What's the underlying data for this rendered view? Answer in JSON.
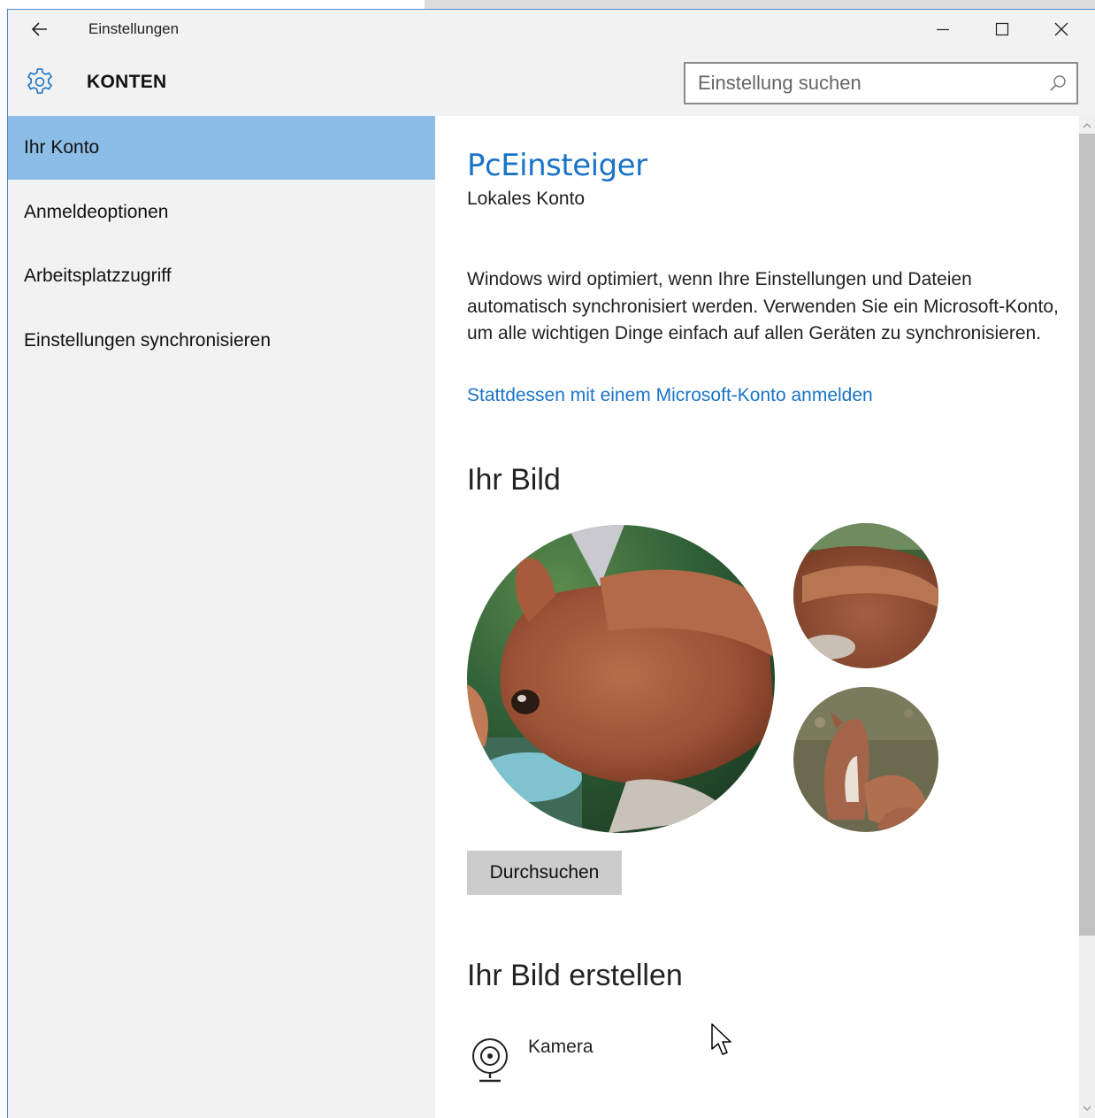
{
  "window": {
    "title": "Einstellungen",
    "controls": {
      "minimize": "minimize-icon",
      "maximize": "maximize-icon",
      "close": "close-icon"
    }
  },
  "header": {
    "section_title": "KONTEN",
    "search_placeholder": "Einstellung suchen"
  },
  "sidebar": {
    "items": [
      {
        "label": "Ihr Konto",
        "selected": true
      },
      {
        "label": "Anmeldeoptionen",
        "selected": false
      },
      {
        "label": "Arbeitsplatzzugriff",
        "selected": false
      },
      {
        "label": "Einstellungen synchronisieren",
        "selected": false
      }
    ]
  },
  "main": {
    "account_name": "PcEinsteiger",
    "account_type": "Lokales Konto",
    "info_text": "Windows wird optimiert, wenn Ihre Einstellungen und Dateien automatisch synchronisiert werden. Verwenden Sie ein Microsoft-Konto, um alle wichtigen Dinge einfach auf allen Geräten zu synchronisieren.",
    "ms_link": "Stattdessen mit einem Microsoft-Konto anmelden",
    "picture_heading": "Ihr Bild",
    "browse_button": "Durchsuchen",
    "create_heading": "Ihr Bild erstellen",
    "camera_label": "Kamera"
  },
  "colors": {
    "accent": "#1a73c8",
    "selected_nav": "#8cbde6",
    "sidebar_bg": "#f2f2f2",
    "button_bg": "#cccccc"
  }
}
